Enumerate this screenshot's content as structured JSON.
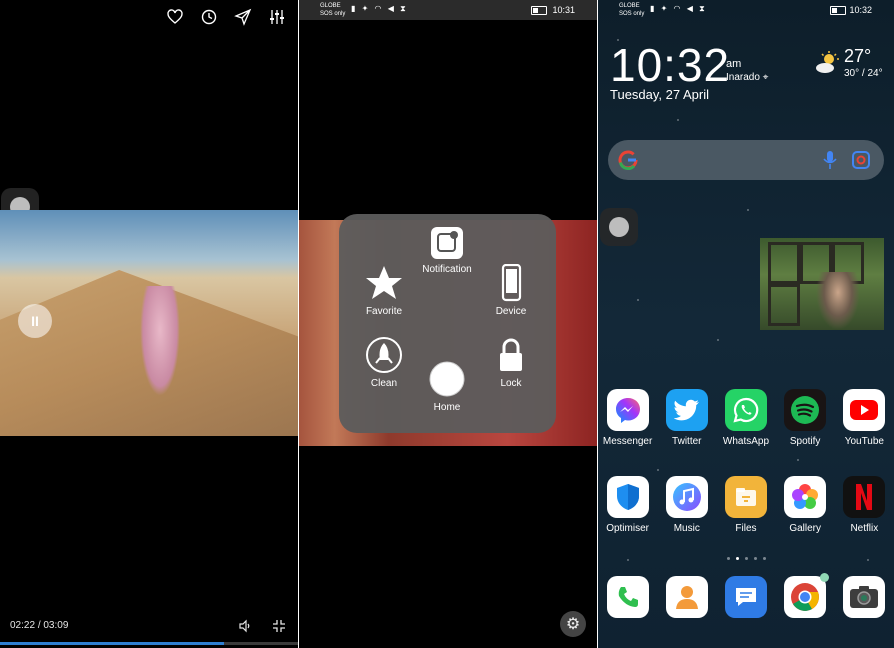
{
  "panel1": {
    "time_current": "02:22",
    "time_sep": "/",
    "time_total": "03:09",
    "progress_fraction": 0.75,
    "top_icons": [
      "heart-icon",
      "clock-icon",
      "send-icon",
      "settings-sliders-icon"
    ],
    "pause_glyph": "II"
  },
  "panel2": {
    "status": {
      "carrier": "GLOBE",
      "carrier2": "SOS only",
      "time": "10:31"
    },
    "menu": {
      "notification": "Notification",
      "favorite": "Favorite",
      "device": "Device",
      "clean": "Clean",
      "home": "Home",
      "lock": "Lock"
    },
    "gear_glyph": "⚙"
  },
  "panel3": {
    "status": {
      "carrier": "GLOBE",
      "carrier2": "SOS only",
      "time": "10:32"
    },
    "clock": {
      "time": "10:32",
      "ampm": "am",
      "location": "Inarado",
      "date": "Tuesday, 27 April"
    },
    "weather": {
      "temp": "27°",
      "range": "30° / 24°"
    },
    "apps_row1": [
      {
        "name": "Messenger",
        "color": "#ffffff"
      },
      {
        "name": "Twitter",
        "color": "#1da1f2"
      },
      {
        "name": "WhatsApp",
        "color": "#25d366"
      },
      {
        "name": "Spotify",
        "color": "#191414"
      },
      {
        "name": "YouTube",
        "color": "#ffffff"
      }
    ],
    "apps_row2": [
      {
        "name": "Optimiser",
        "color": "#ffffff"
      },
      {
        "name": "Music",
        "color": "#ffffff"
      },
      {
        "name": "Files",
        "color": "#f2b43a"
      },
      {
        "name": "Gallery",
        "color": "#ffffff"
      },
      {
        "name": "Netflix",
        "color": "#111111"
      }
    ],
    "dock": [
      {
        "name": "phone-app",
        "color": "#ffffff"
      },
      {
        "name": "contacts-app",
        "color": "#ffffff"
      },
      {
        "name": "messages-app",
        "color": "#2f7be5"
      },
      {
        "name": "chrome-app",
        "color": "#ffffff"
      },
      {
        "name": "camera-app",
        "color": "#ffffff"
      }
    ],
    "page_dots": 5,
    "active_dot": 1
  }
}
